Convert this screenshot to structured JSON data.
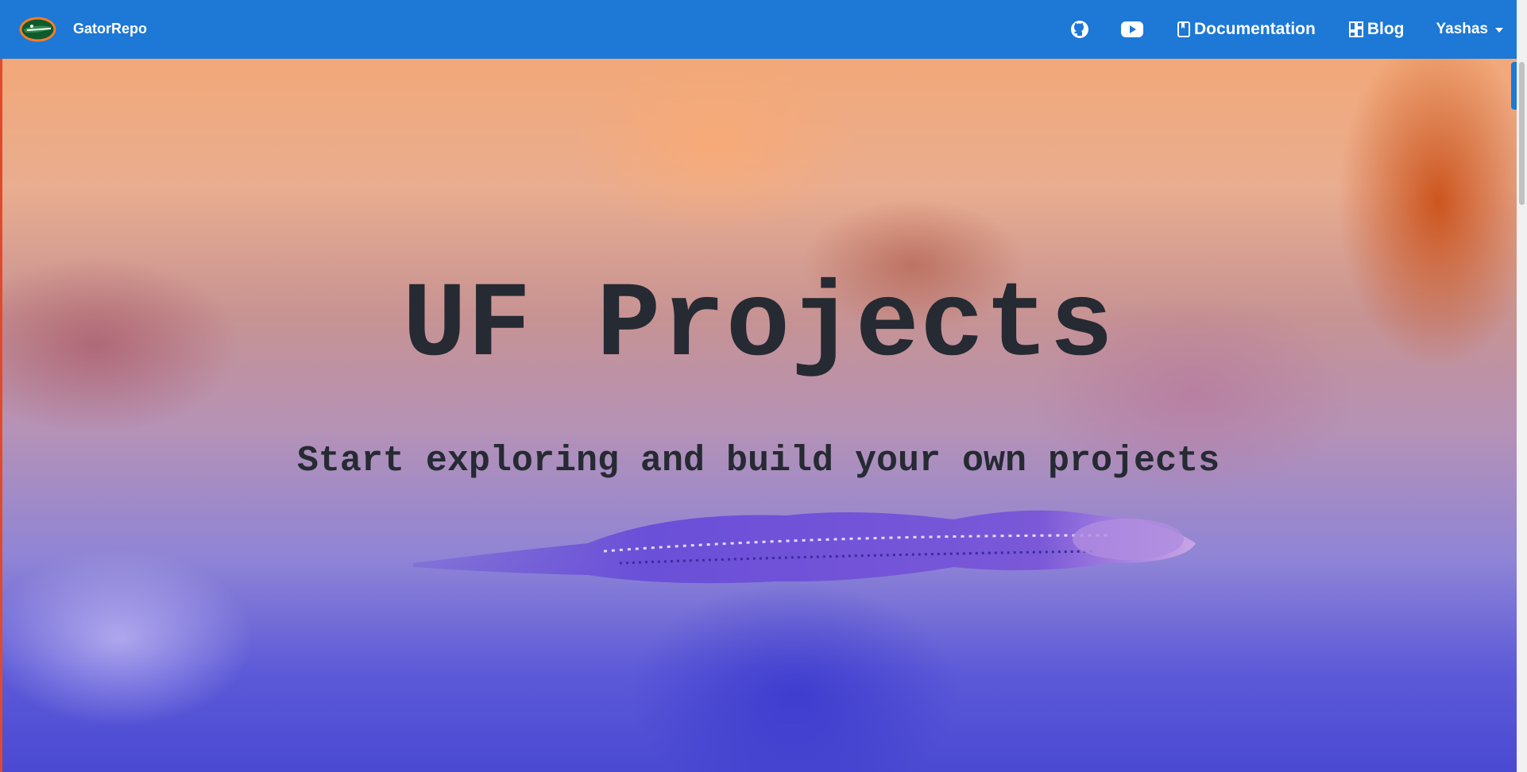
{
  "navbar": {
    "brand": {
      "logo_icon": "gator-logo-icon",
      "name": "GatorRepo"
    },
    "github_icon": "github-icon",
    "youtube_icon": "youtube-icon",
    "links": [
      {
        "icon": "book-icon",
        "label": "Documentation"
      },
      {
        "icon": "dashboard-icon",
        "label": "Blog"
      }
    ],
    "user_menu": {
      "label": "Yashas",
      "icon": "caret-down-icon"
    }
  },
  "hero": {
    "title": "UF Projects",
    "subtitle": "Start exploring and build your own projects"
  },
  "colors": {
    "navbar": "#1d78d6",
    "text_dark": "#262a33"
  }
}
